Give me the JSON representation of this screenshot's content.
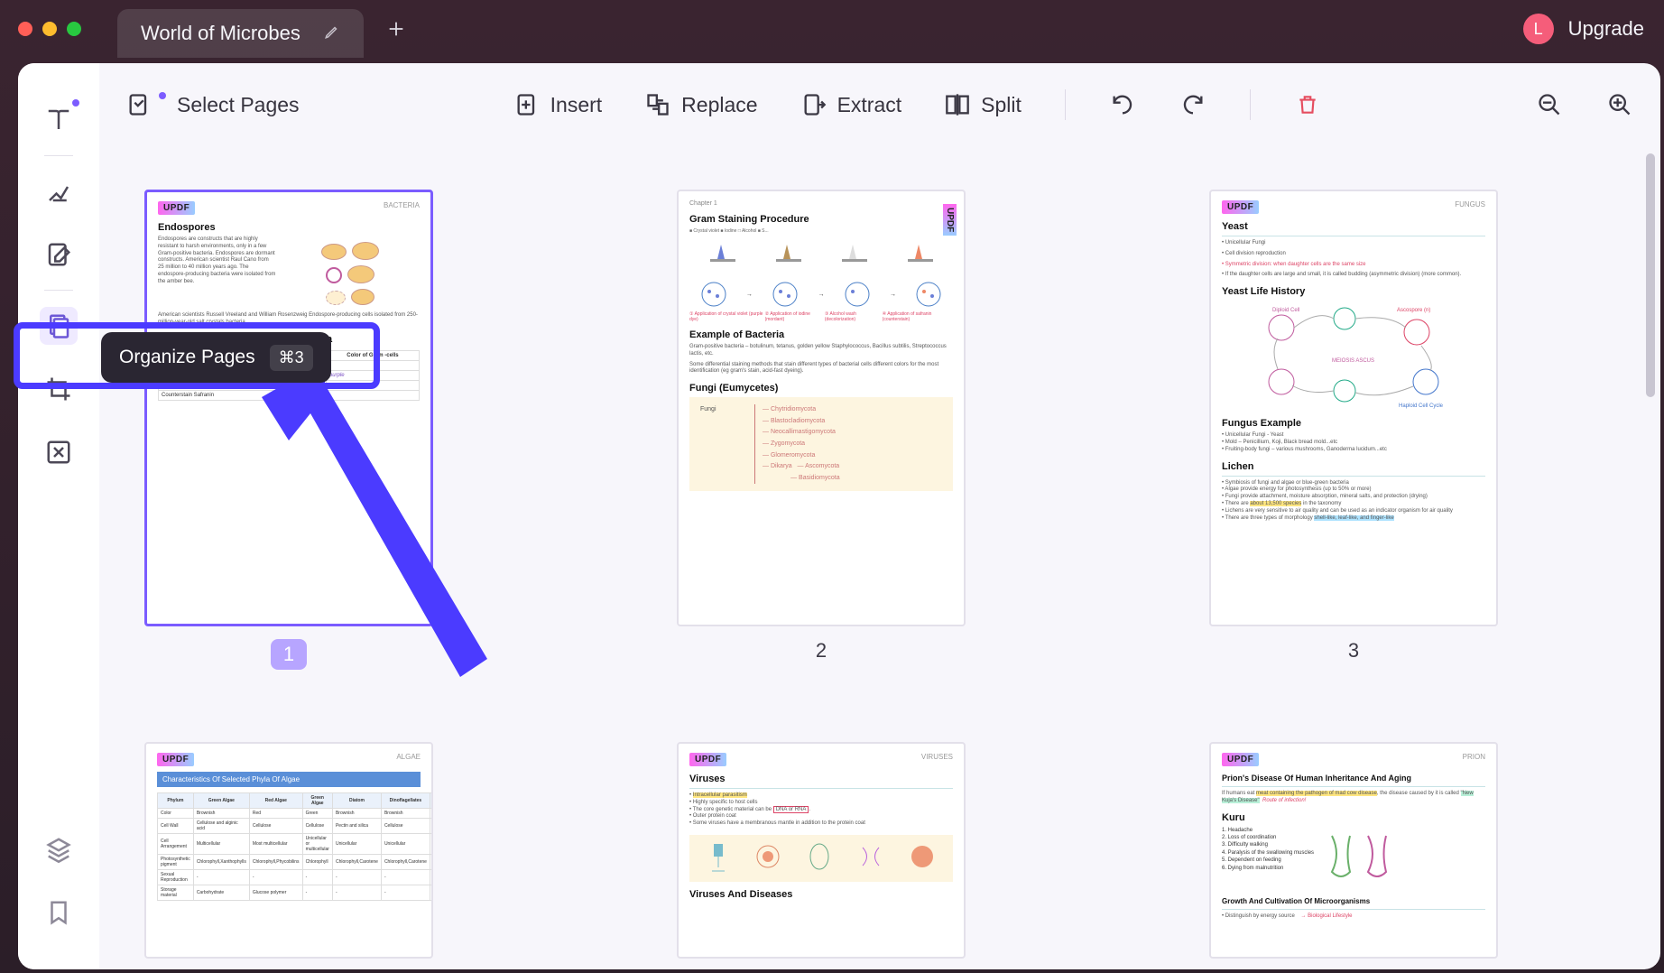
{
  "window": {
    "title": "World of Microbes"
  },
  "header": {
    "upgrade": "Upgrade",
    "avatar_letter": "L"
  },
  "toolbar": {
    "select_pages": "Select Pages",
    "insert": "Insert",
    "replace": "Replace",
    "extract": "Extract",
    "split": "Split"
  },
  "tooltip": {
    "label": "Organize Pages",
    "shortcut": "⌘3"
  },
  "pages": [
    {
      "number": "1",
      "selected": true,
      "brand": "UPDF",
      "corner": "BACTERIA",
      "h1": "Endospores",
      "p1": "Endospores are constructs that are highly resistant to harsh environments, only in a few Gram-positive bacteria. Endospores are dormant constructs. American scientist Raul Cano from 25 million to 40 million years ago. The endospore-producing bacteria were isolated from the amber bee.",
      "p2": "American scientists Russell Vreeland and William Rosenzweig Endospore-producing cells isolated from 250-million-year-old salt crystals bacteria.",
      "h2": "Staining and Observation of Bacteria"
    },
    {
      "number": "2",
      "selected": false,
      "brand": "UPDF",
      "corner": "Chapter 1",
      "h1": "Gram Staining Procedure",
      "h2": "Example of Bacteria",
      "p1": "Gram-positive bacteria – botulinum, tetanus, golden yellow Staphylococcus, Bacillus subtilis, Streptococcus lactis, etc.",
      "p2": "Some differential staining methods that stain different types of bacterial cells different colors for the most identification (eg gram's stain, acid-fast dyeing).",
      "h3": "Fungi  (Eumycetes)"
    },
    {
      "number": "3",
      "selected": false,
      "brand": "UPDF",
      "corner": "FUNGUS",
      "h1": "Yeast",
      "b1": "Unicellular Fungi",
      "b2": "Cell division reproduction",
      "b3": "Symmetric division: when daughter cells are the same size",
      "b4": "If the daughter cells are large and small, it is called budding (asymmetric division) (more common).",
      "h2": "Yeast Life History",
      "h3": "Fungus Example",
      "h4": "Lichen"
    },
    {
      "number": "4",
      "selected": false,
      "brand": "UPDF",
      "corner": "ALGAE",
      "h1": "Characteristics Of Selected Phyla Of Algae"
    },
    {
      "number": "5",
      "selected": false,
      "brand": "UPDF",
      "corner": "VIRUSES",
      "h1": "Viruses",
      "h2": "Viruses And Diseases"
    },
    {
      "number": "6",
      "selected": false,
      "brand": "UPDF",
      "corner": "PRION",
      "h1": "Prion's Disease Of Human Inheritance And Aging",
      "h2": "Kuru",
      "h3": "Growth And Cultivation Of Microorganisms"
    }
  ]
}
